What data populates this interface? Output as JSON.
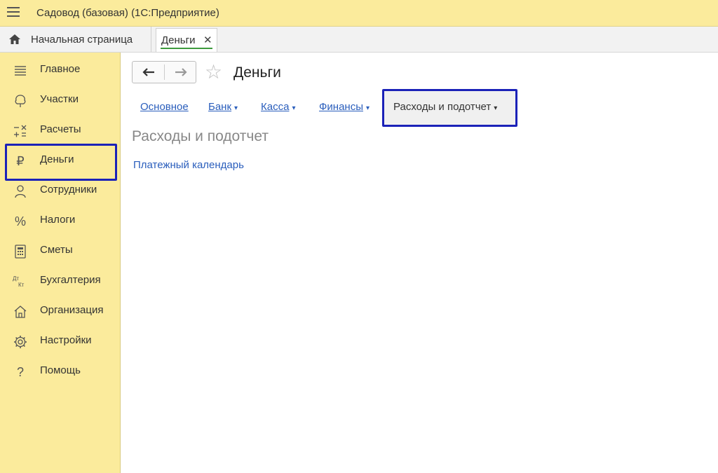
{
  "titlebar": {
    "app_title": "Садовод (базовая)  (1С:Предприятие)"
  },
  "tabs": {
    "home_label": "Начальная страница",
    "active_label": "Деньги",
    "close_symbol": "✕"
  },
  "sidebar": {
    "items": [
      {
        "label": "Главное",
        "icon": "list-icon"
      },
      {
        "label": "Участки",
        "icon": "tree-icon"
      },
      {
        "label": "Расчеты",
        "icon": "calc-operations-icon"
      },
      {
        "label": "Деньги",
        "icon": "ruble-icon"
      },
      {
        "label": "Сотрудники",
        "icon": "person-icon"
      },
      {
        "label": "Налоги",
        "icon": "percent-icon"
      },
      {
        "label": "Сметы",
        "icon": "calculator-icon"
      },
      {
        "label": "Бухгалтерия",
        "icon": "dt-kt-icon"
      },
      {
        "label": "Организация",
        "icon": "house-icon"
      },
      {
        "label": "Настройки",
        "icon": "gear-icon"
      },
      {
        "label": "Помощь",
        "icon": "question-icon"
      }
    ],
    "glyphs": {
      "ruble": "₽",
      "percent": "%",
      "dt": "Дт",
      "kt": "Кт",
      "question": "?"
    }
  },
  "content": {
    "nav_back": "🡐",
    "nav_forward": "🡒",
    "star": "☆",
    "page_title": "Деньги",
    "section_links": [
      {
        "label": "Основное",
        "has_arrow": false
      },
      {
        "label": "Банк",
        "has_arrow": true
      },
      {
        "label": "Касса",
        "has_arrow": true
      },
      {
        "label": "Финансы",
        "has_arrow": true
      }
    ],
    "arrow_symbol": "▾",
    "active_section": "Расходы и подотчет",
    "section_heading": "Расходы и подотчет",
    "links": [
      "Платежный календарь"
    ]
  },
  "colors": {
    "panel": "#fbeb9c",
    "highlight": "#1b22b8",
    "link": "#2a5ebc",
    "tab_accent": "#3e9a3e"
  }
}
